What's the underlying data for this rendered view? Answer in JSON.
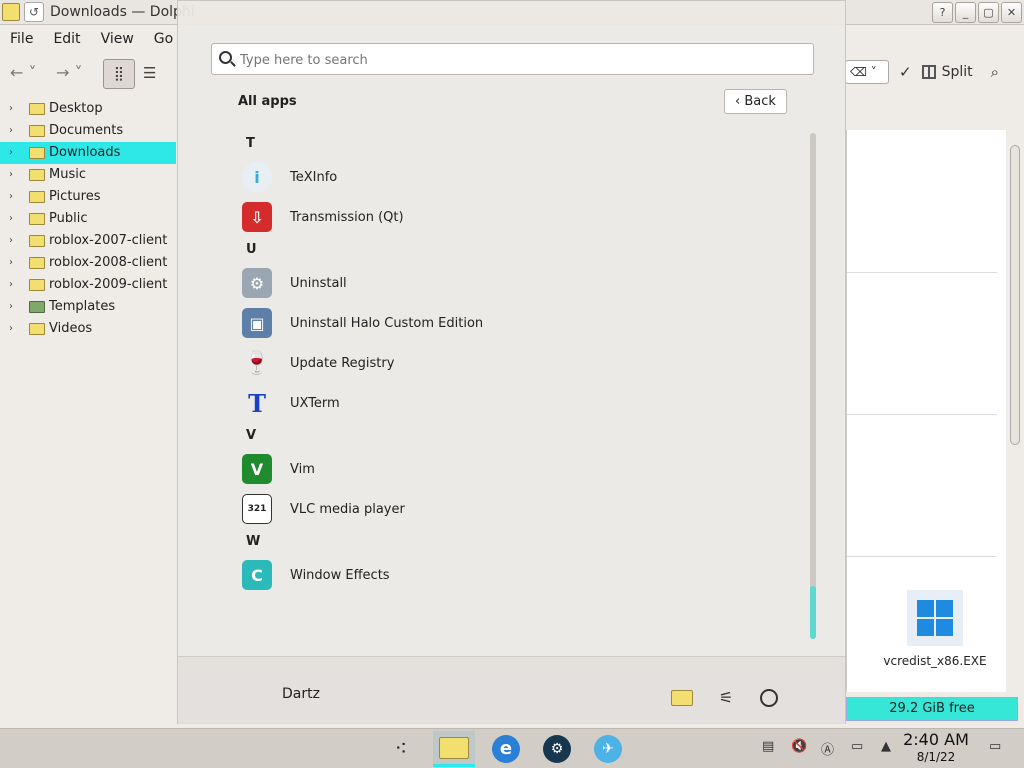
{
  "window": {
    "title": "Downloads — Dolphi",
    "buttons": [
      "?",
      "_",
      "▢",
      "✕"
    ]
  },
  "menu": [
    "File",
    "Edit",
    "View",
    "Go"
  ],
  "toolbar": {
    "split_label": "Split"
  },
  "places": [
    {
      "label": "Desktop",
      "icon": "desktop-icon"
    },
    {
      "label": "Documents",
      "icon": "documents-folder-icon"
    },
    {
      "label": "Downloads",
      "icon": "downloads-folder-icon",
      "active": true
    },
    {
      "label": "Music",
      "icon": "music-folder-icon"
    },
    {
      "label": "Pictures",
      "icon": "pictures-folder-icon"
    },
    {
      "label": "Public",
      "icon": "public-folder-icon"
    },
    {
      "label": "roblox-2007-client",
      "icon": "folder-icon"
    },
    {
      "label": "roblox-2008-client",
      "icon": "folder-icon"
    },
    {
      "label": "roblox-2009-client",
      "icon": "folder-icon"
    },
    {
      "label": "Templates",
      "icon": "templates-folder-icon"
    },
    {
      "label": "Videos",
      "icon": "videos-folder-icon"
    }
  ],
  "files": {
    "visible_item": "vcredist_x86.EXE",
    "free_space": "29.2 GiB free"
  },
  "launcher": {
    "search_placeholder": "Type here to search",
    "heading": "All apps",
    "back_label": "Back",
    "groups": [
      {
        "letter": "T",
        "apps": [
          {
            "name": "TeXInfo",
            "icon": "texinfo-icon"
          },
          {
            "name": "Transmission (Qt)",
            "icon": "transmission-icon"
          }
        ]
      },
      {
        "letter": "U",
        "apps": [
          {
            "name": "Uninstall",
            "icon": "uninstall-icon"
          },
          {
            "name": "Uninstall Halo Custom Edition",
            "icon": "uninstall-halo-icon"
          },
          {
            "name": "Update Registry",
            "icon": "wine-glass-icon"
          },
          {
            "name": "UXTerm",
            "icon": "uxterm-icon"
          }
        ]
      },
      {
        "letter": "V",
        "apps": [
          {
            "name": "Vim",
            "icon": "vim-icon"
          },
          {
            "name": "VLC media player",
            "icon": "vlc-icon"
          }
        ]
      },
      {
        "letter": "W",
        "apps": [
          {
            "name": "Window Effects",
            "icon": "window-effects-icon"
          }
        ]
      }
    ],
    "user_name": "Dartz"
  },
  "taskbar": {
    "time": "2:40 AM",
    "date": "8/1/22"
  },
  "colors": {
    "accent": "#2ee8e8",
    "folder": "#f3df70"
  }
}
